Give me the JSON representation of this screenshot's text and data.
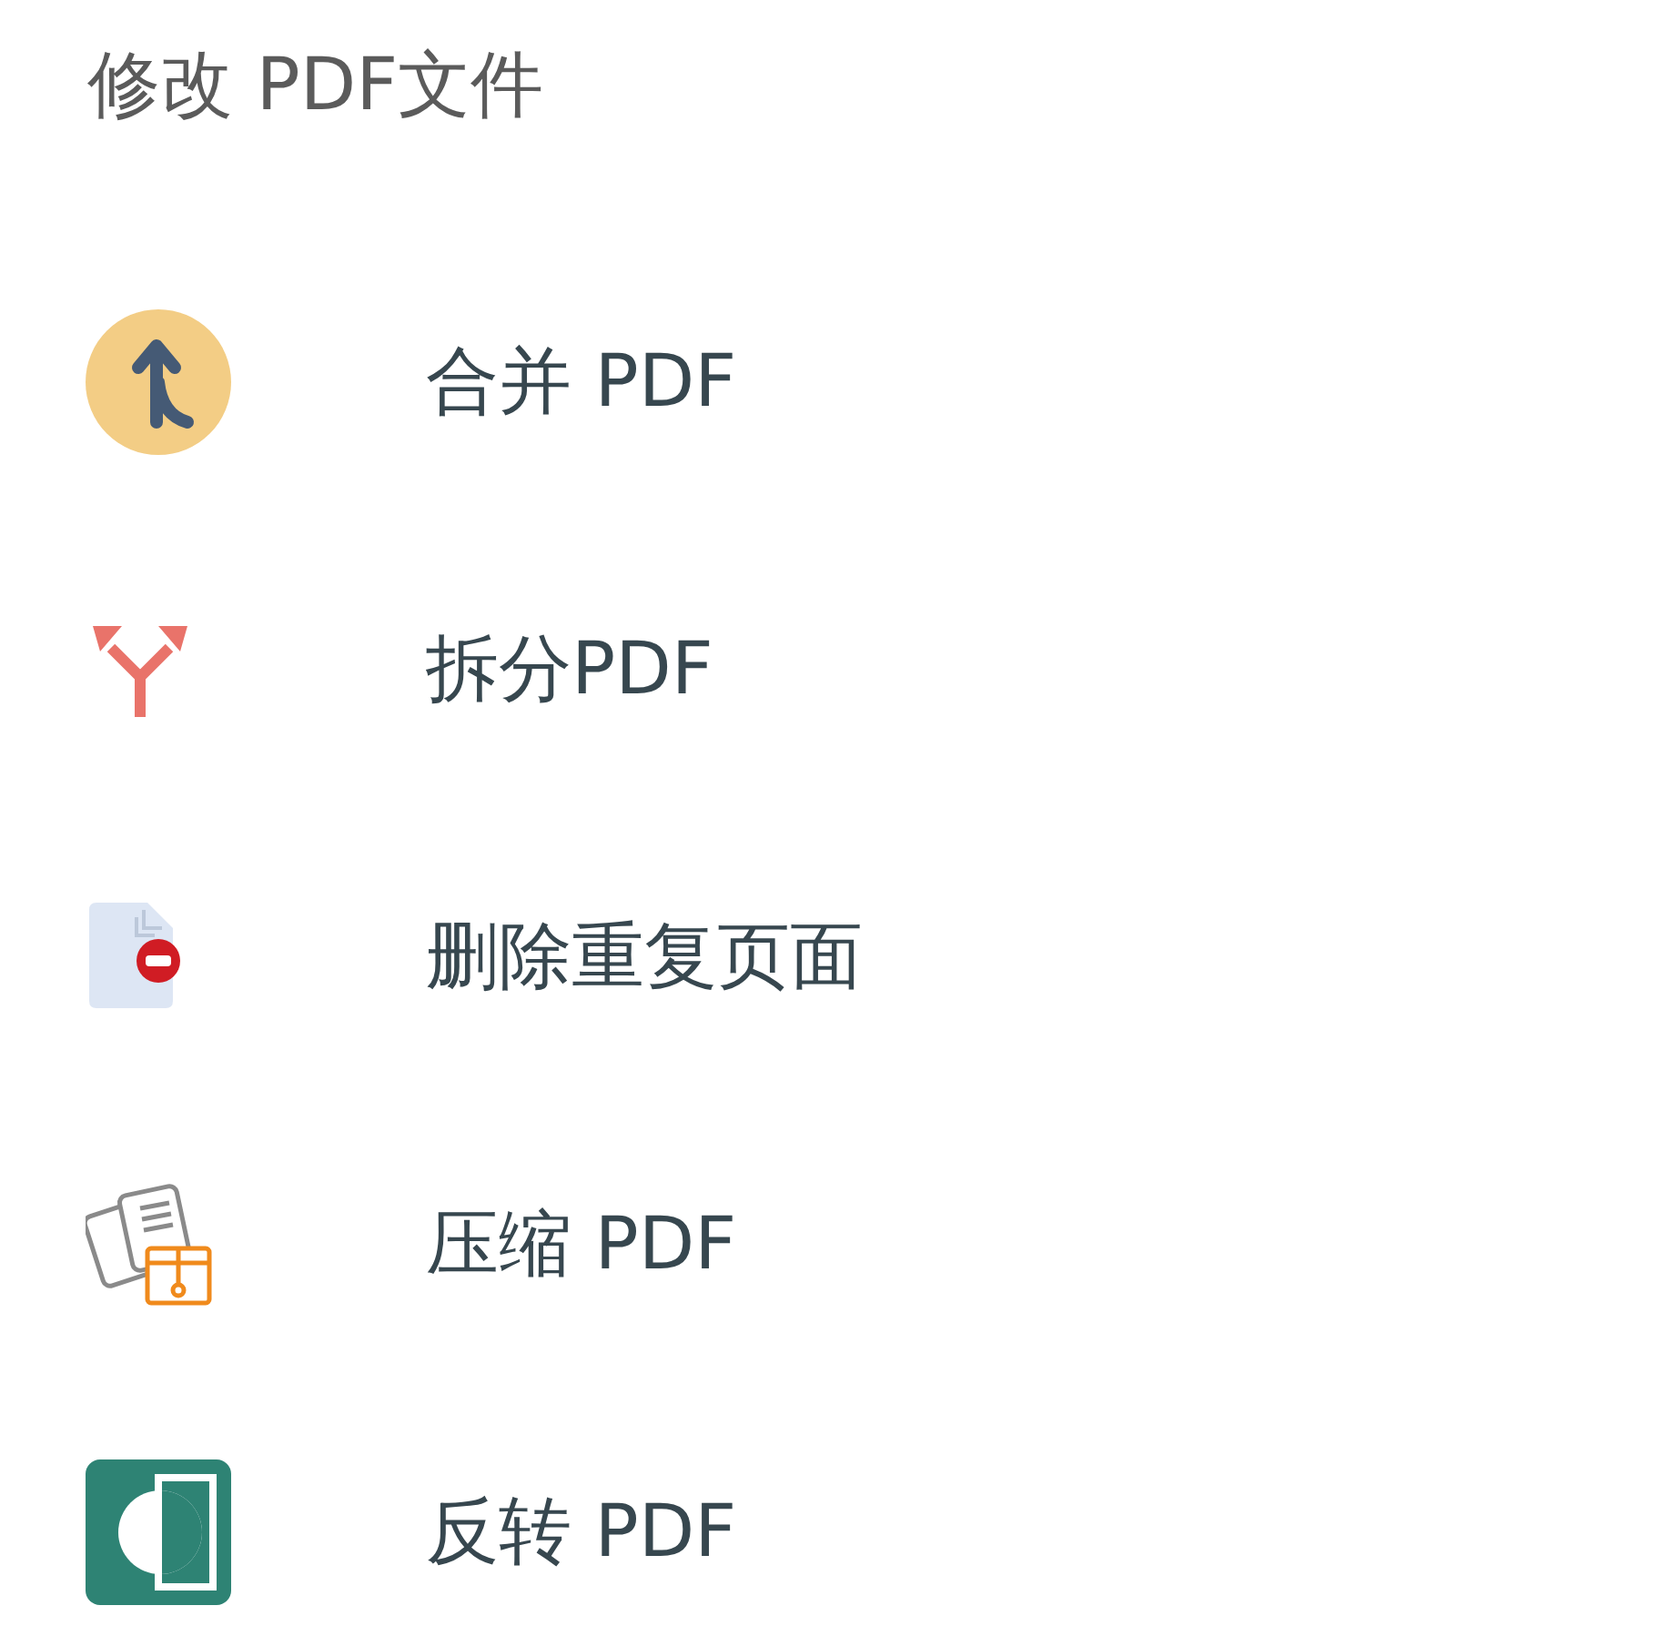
{
  "section_title": "修改 PDF文件",
  "tools": [
    {
      "kind": "merge",
      "label": "合并 PDF"
    },
    {
      "kind": "split",
      "label": "拆分PDF"
    },
    {
      "kind": "remove",
      "label": "删除重复页面"
    },
    {
      "kind": "compress",
      "label": "压缩 PDF"
    },
    {
      "kind": "reverse",
      "label": "反转 PDF"
    }
  ]
}
